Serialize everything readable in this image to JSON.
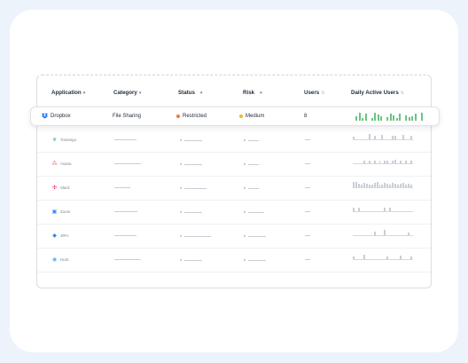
{
  "headers": {
    "application": "Application",
    "category": "Category",
    "status": "Status",
    "risk": "Risk",
    "users": "Users",
    "dau": "Daily Active Users"
  },
  "main_row": {
    "app": "Dropbox",
    "category": "File Sharing",
    "status": "Restricted",
    "status_color": "#f07a3a",
    "risk": "Medium",
    "risk_color": "#f2b82c",
    "users": "8",
    "dau_values": [
      0.5,
      0.95,
      0.3,
      0.8,
      0,
      0.35,
      0.9,
      0.7,
      0.55,
      0,
      0.4,
      0.8,
      0.65,
      0.3,
      0.85,
      0,
      0.6,
      0.45,
      0.5,
      0.8,
      0,
      0.95
    ]
  },
  "faded_rows": [
    {
      "app": "Tomango",
      "icon": "tomango-icon",
      "icon_color": "#6cc384",
      "dau": [
        0.5,
        0,
        0,
        0,
        0,
        0,
        0.8,
        0,
        0.6,
        0,
        0,
        0.7,
        0,
        0,
        0,
        0.6,
        0.6,
        0,
        0,
        0.7,
        0,
        0,
        0.6
      ]
    },
    {
      "app": "Asana",
      "icon": "asana-icon",
      "icon_color": "#f06a6a",
      "dau": [
        0,
        0,
        0,
        0,
        0.4,
        0,
        0.4,
        0,
        0.4,
        0,
        0.5,
        0,
        0.4,
        0.4,
        0,
        0.4,
        0.6,
        0,
        0.4,
        0,
        0.4,
        0,
        0.5
      ]
    },
    {
      "app": "Slack",
      "icon": "slack-icon",
      "icon_color": "#e01e5a",
      "dau": [
        0.9,
        0.9,
        0.6,
        0.5,
        0.7,
        0.6,
        0.5,
        0.4,
        0.7,
        0.8,
        0.5,
        0.5,
        0.7,
        0.6,
        0.5,
        0.7,
        0.6,
        0.5,
        0.6,
        0.7,
        0.5,
        0.6,
        0.4
      ]
    },
    {
      "app": "Zoom",
      "icon": "zoom-icon",
      "icon_color": "#2d8cff",
      "dau": [
        0.6,
        0,
        0.6,
        0,
        0,
        0,
        0,
        0,
        0,
        0,
        0,
        0,
        0.6,
        0,
        0.6,
        0,
        0,
        0,
        0,
        0,
        0,
        0,
        0
      ]
    },
    {
      "app": "JIRA",
      "icon": "jira-icon",
      "icon_color": "#2684ff",
      "dau": [
        0,
        0,
        0,
        0,
        0,
        0,
        0,
        0,
        0.6,
        0,
        0,
        0,
        0.9,
        0,
        0,
        0,
        0,
        0,
        0,
        0,
        0,
        0.5,
        0
      ]
    },
    {
      "app": "Hunt",
      "icon": "hunt-icon",
      "icon_color": "#5aa9f0",
      "dau": [
        0.5,
        0,
        0,
        0,
        0.7,
        0,
        0,
        0,
        0,
        0,
        0,
        0,
        0,
        0.5,
        0,
        0,
        0,
        0,
        0.6,
        0,
        0,
        0,
        0.5
      ]
    }
  ]
}
